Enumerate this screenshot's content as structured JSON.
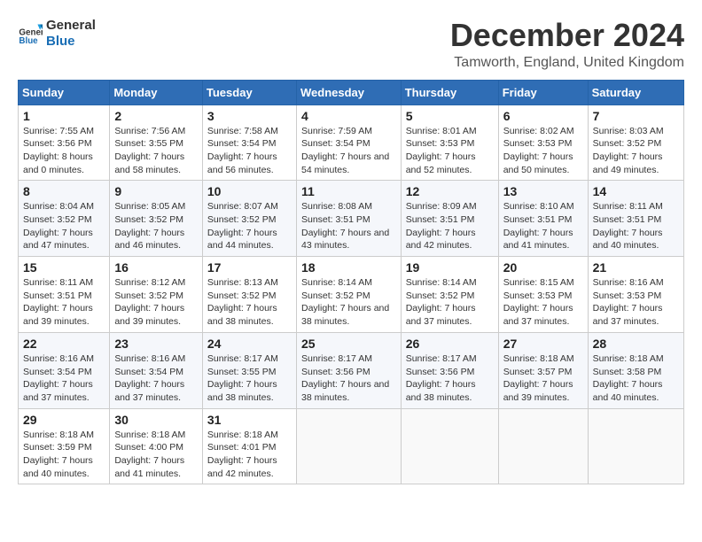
{
  "logo": {
    "line1": "General",
    "line2": "Blue"
  },
  "title": "December 2024",
  "subtitle": "Tamworth, England, United Kingdom",
  "weekdays": [
    "Sunday",
    "Monday",
    "Tuesday",
    "Wednesday",
    "Thursday",
    "Friday",
    "Saturday"
  ],
  "weeks": [
    [
      {
        "day": "1",
        "sunrise": "7:55 AM",
        "sunset": "3:56 PM",
        "daylight": "8 hours and 0 minutes."
      },
      {
        "day": "2",
        "sunrise": "7:56 AM",
        "sunset": "3:55 PM",
        "daylight": "7 hours and 58 minutes."
      },
      {
        "day": "3",
        "sunrise": "7:58 AM",
        "sunset": "3:54 PM",
        "daylight": "7 hours and 56 minutes."
      },
      {
        "day": "4",
        "sunrise": "7:59 AM",
        "sunset": "3:54 PM",
        "daylight": "7 hours and 54 minutes."
      },
      {
        "day": "5",
        "sunrise": "8:01 AM",
        "sunset": "3:53 PM",
        "daylight": "7 hours and 52 minutes."
      },
      {
        "day": "6",
        "sunrise": "8:02 AM",
        "sunset": "3:53 PM",
        "daylight": "7 hours and 50 minutes."
      },
      {
        "day": "7",
        "sunrise": "8:03 AM",
        "sunset": "3:52 PM",
        "daylight": "7 hours and 49 minutes."
      }
    ],
    [
      {
        "day": "8",
        "sunrise": "8:04 AM",
        "sunset": "3:52 PM",
        "daylight": "7 hours and 47 minutes."
      },
      {
        "day": "9",
        "sunrise": "8:05 AM",
        "sunset": "3:52 PM",
        "daylight": "7 hours and 46 minutes."
      },
      {
        "day": "10",
        "sunrise": "8:07 AM",
        "sunset": "3:52 PM",
        "daylight": "7 hours and 44 minutes."
      },
      {
        "day": "11",
        "sunrise": "8:08 AM",
        "sunset": "3:51 PM",
        "daylight": "7 hours and 43 minutes."
      },
      {
        "day": "12",
        "sunrise": "8:09 AM",
        "sunset": "3:51 PM",
        "daylight": "7 hours and 42 minutes."
      },
      {
        "day": "13",
        "sunrise": "8:10 AM",
        "sunset": "3:51 PM",
        "daylight": "7 hours and 41 minutes."
      },
      {
        "day": "14",
        "sunrise": "8:11 AM",
        "sunset": "3:51 PM",
        "daylight": "7 hours and 40 minutes."
      }
    ],
    [
      {
        "day": "15",
        "sunrise": "8:11 AM",
        "sunset": "3:51 PM",
        "daylight": "7 hours and 39 minutes."
      },
      {
        "day": "16",
        "sunrise": "8:12 AM",
        "sunset": "3:52 PM",
        "daylight": "7 hours and 39 minutes."
      },
      {
        "day": "17",
        "sunrise": "8:13 AM",
        "sunset": "3:52 PM",
        "daylight": "7 hours and 38 minutes."
      },
      {
        "day": "18",
        "sunrise": "8:14 AM",
        "sunset": "3:52 PM",
        "daylight": "7 hours and 38 minutes."
      },
      {
        "day": "19",
        "sunrise": "8:14 AM",
        "sunset": "3:52 PM",
        "daylight": "7 hours and 37 minutes."
      },
      {
        "day": "20",
        "sunrise": "8:15 AM",
        "sunset": "3:53 PM",
        "daylight": "7 hours and 37 minutes."
      },
      {
        "day": "21",
        "sunrise": "8:16 AM",
        "sunset": "3:53 PM",
        "daylight": "7 hours and 37 minutes."
      }
    ],
    [
      {
        "day": "22",
        "sunrise": "8:16 AM",
        "sunset": "3:54 PM",
        "daylight": "7 hours and 37 minutes."
      },
      {
        "day": "23",
        "sunrise": "8:16 AM",
        "sunset": "3:54 PM",
        "daylight": "7 hours and 37 minutes."
      },
      {
        "day": "24",
        "sunrise": "8:17 AM",
        "sunset": "3:55 PM",
        "daylight": "7 hours and 38 minutes."
      },
      {
        "day": "25",
        "sunrise": "8:17 AM",
        "sunset": "3:56 PM",
        "daylight": "7 hours and 38 minutes."
      },
      {
        "day": "26",
        "sunrise": "8:17 AM",
        "sunset": "3:56 PM",
        "daylight": "7 hours and 38 minutes."
      },
      {
        "day": "27",
        "sunrise": "8:18 AM",
        "sunset": "3:57 PM",
        "daylight": "7 hours and 39 minutes."
      },
      {
        "day": "28",
        "sunrise": "8:18 AM",
        "sunset": "3:58 PM",
        "daylight": "7 hours and 40 minutes."
      }
    ],
    [
      {
        "day": "29",
        "sunrise": "8:18 AM",
        "sunset": "3:59 PM",
        "daylight": "7 hours and 40 minutes."
      },
      {
        "day": "30",
        "sunrise": "8:18 AM",
        "sunset": "4:00 PM",
        "daylight": "7 hours and 41 minutes."
      },
      {
        "day": "31",
        "sunrise": "8:18 AM",
        "sunset": "4:01 PM",
        "daylight": "7 hours and 42 minutes."
      },
      null,
      null,
      null,
      null
    ]
  ]
}
